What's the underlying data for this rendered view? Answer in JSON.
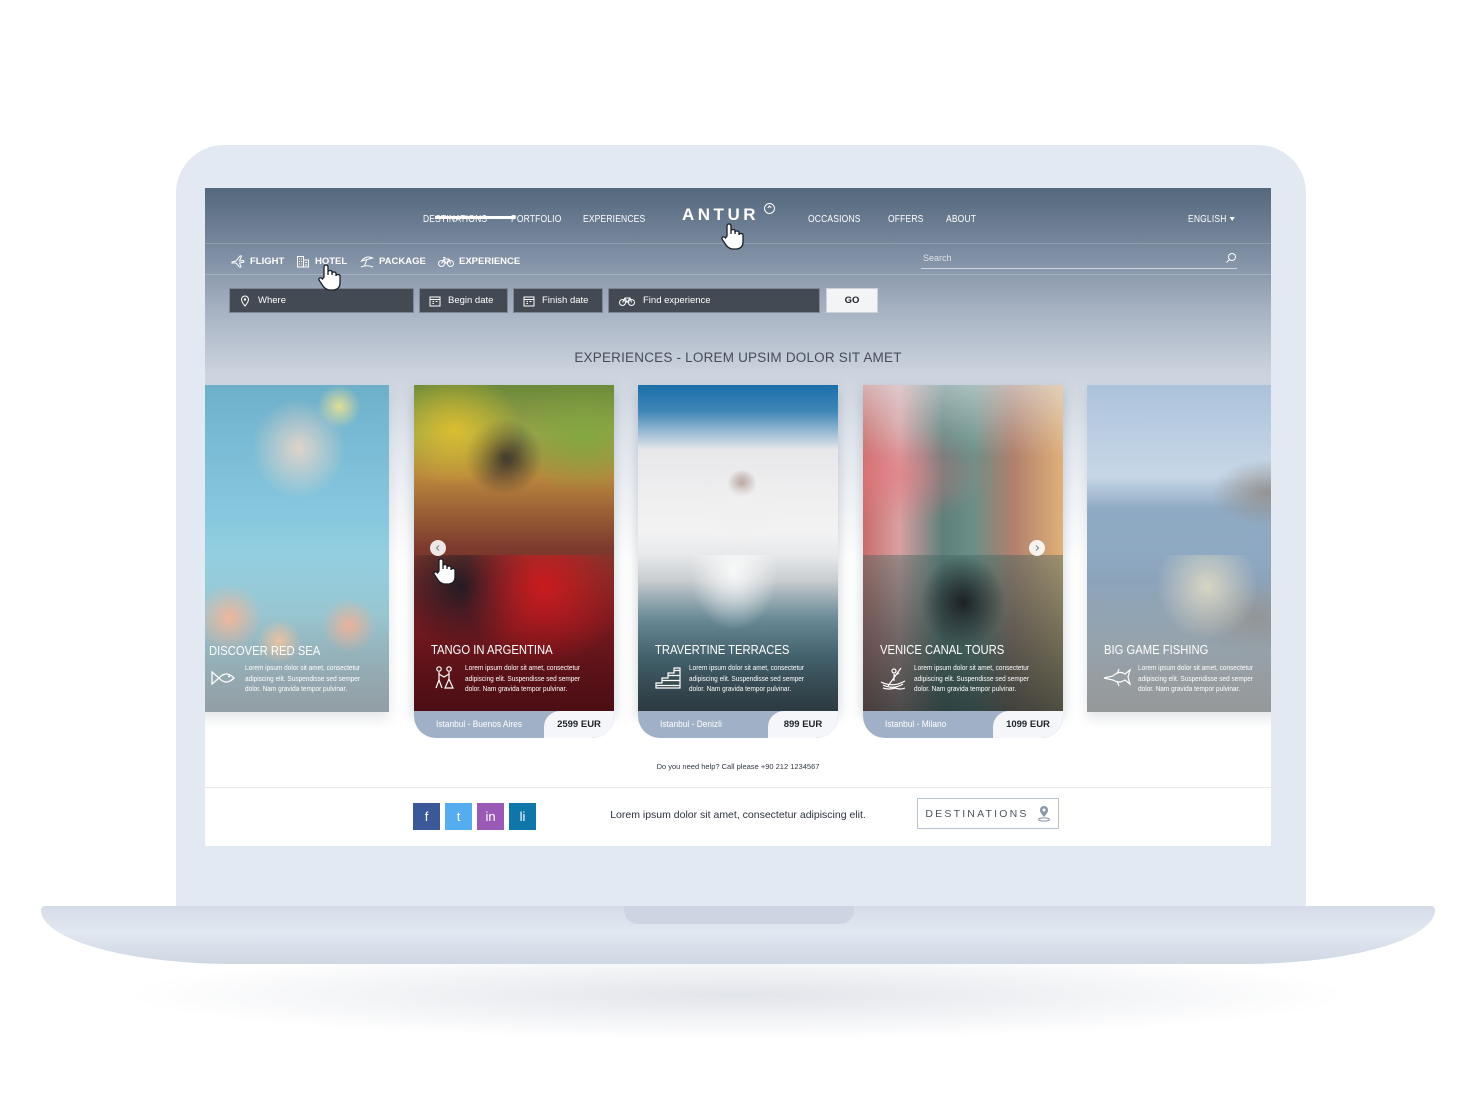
{
  "app": {
    "logo": "ANTUR"
  },
  "nav": {
    "left": [
      "DESTINATIONS",
      "PORTFOLIO",
      "EXPERIENCES"
    ],
    "right": [
      "OCCASIONS",
      "OFFERS",
      "ABOUT"
    ],
    "language": "ENGLISH"
  },
  "subtabs": [
    {
      "label": "FLIGHT",
      "icon": "plane-icon"
    },
    {
      "label": "HOTEL",
      "icon": "hotel-icon"
    },
    {
      "label": "PACKAGE",
      "icon": "beach-umbrella-icon"
    },
    {
      "label": "EXPERIENCE",
      "icon": "bicycle-icon",
      "active": true
    }
  ],
  "search": {
    "placeholder": "Search"
  },
  "booking": {
    "where": "Where",
    "begin_date": "Begin date",
    "finish_date": "Finish date",
    "find_experience": "Find experience",
    "go": "GO"
  },
  "section": {
    "title": "EXPERIENCES - LOREM UPSIM DOLOR SIT AMET"
  },
  "cards": [
    {
      "title": "DISCOVER RED SEA",
      "icon": "fish-icon",
      "desc": "Lorem ipsum dolor sit amet, consectetur adipiscing elit. Suspendisse sed semper dolor. Nam gravida tempor pulvinar."
    },
    {
      "title": "TANGO IN ARGENTINA",
      "icon": "dancers-icon",
      "desc": "Lorem ipsum dolor sit amet, consectetur adipiscing elit. Suspendisse sed semper dolor. Nam gravida tempor pulvinar.",
      "route": "Istanbul - Buenos Aires",
      "price": "2599 EUR"
    },
    {
      "title": "TRAVERTINE TERRACES",
      "icon": "terraces-icon",
      "desc": "Lorem ipsum dolor sit amet, consectetur adipiscing elit. Suspendisse sed semper dolor. Nam gravida tempor pulvinar.",
      "route": "Istanbul - Denizli",
      "price": "899 EUR"
    },
    {
      "title": "VENICE CANAL TOURS",
      "icon": "gondola-icon",
      "desc": "Lorem ipsum dolor sit amet, consectetur adipiscing elit. Suspendisse sed semper dolor. Nam gravida tempor pulvinar.",
      "route": "Istanbul - Milano",
      "price": "1099 EUR"
    },
    {
      "title": "BIG GAME FISHING",
      "icon": "swordfish-icon",
      "desc": "Lorem ipsum dolor sit amet, consectetur adipiscing elit. Suspendisse sed semper dolor. Nam gravida tempor pulvinar."
    }
  ],
  "help": {
    "text": "Do you need help? Call please +90 212 1234567"
  },
  "footer": {
    "social": [
      {
        "label": "f",
        "icon": "facebook-icon",
        "color": "#3b5998"
      },
      {
        "label": "t",
        "icon": "twitter-icon",
        "color": "#55acee"
      },
      {
        "label": "in",
        "icon": "instagram-icon",
        "color": "#9b59b6"
      },
      {
        "label": "li",
        "icon": "linkedin-icon",
        "color": "#0e76a8"
      }
    ],
    "tagline": "Lorem ipsum dolor sit amet, consectetur adipiscing elit.",
    "destinations_button": "DESTINATIONS"
  },
  "colors": {
    "nav_dark": "#54677d",
    "field_bg": "#434a53",
    "card_footer": "#a0b1c7"
  }
}
